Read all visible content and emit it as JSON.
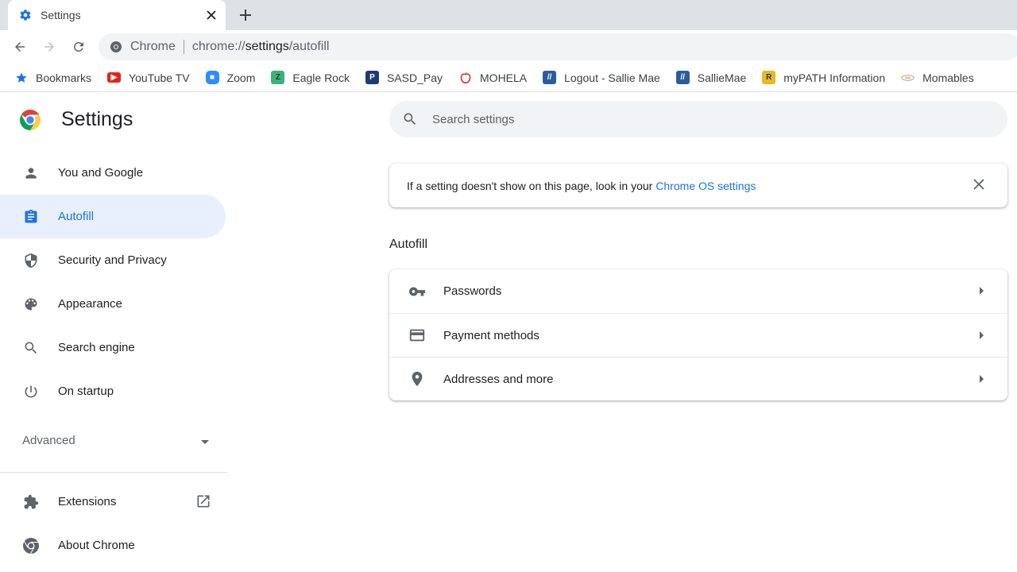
{
  "tab": {
    "title": "Settings",
    "icon": "gear-icon"
  },
  "toolbar": {
    "omnibox_site": "Chrome",
    "url_prefix": "chrome://",
    "url_host": "settings",
    "url_path": "/autofill"
  },
  "bookmarks": [
    {
      "label": "Bookmarks",
      "icon": "star-icon",
      "color": "#1a73e8"
    },
    {
      "label": "YouTube TV",
      "icon": "youtube-tv-icon",
      "color": "#e62117"
    },
    {
      "label": "Zoom",
      "icon": "zoom-icon",
      "color": "#2d8cff"
    },
    {
      "label": "Eagle Rock",
      "icon": "eagle-rock-icon",
      "color": "#3bb27e"
    },
    {
      "label": "SASD_Pay",
      "icon": "sasd-pay-icon",
      "color": "#1d3a7a"
    },
    {
      "label": "MOHELA",
      "icon": "apple-icon",
      "color": "#e02424"
    },
    {
      "label": "Logout - Sallie Mae",
      "icon": "sallie-mae-icon",
      "color": "#2a5d9f"
    },
    {
      "label": "SallieMae",
      "icon": "sallie-mae-icon",
      "color": "#2a5d9f"
    },
    {
      "label": "myPATH Information",
      "icon": "mypath-icon",
      "color": "#1d3a7a"
    },
    {
      "label": "Momables",
      "icon": "momables-icon",
      "color": "#9aa0a6"
    }
  ],
  "sidebar": {
    "title": "Settings",
    "items": [
      {
        "label": "You and Google",
        "icon": "person-icon"
      },
      {
        "label": "Autofill",
        "icon": "clipboard-icon",
        "active": true
      },
      {
        "label": "Security and Privacy",
        "icon": "shield-icon"
      },
      {
        "label": "Appearance",
        "icon": "palette-icon"
      },
      {
        "label": "Search engine",
        "icon": "search-icon"
      },
      {
        "label": "On startup",
        "icon": "power-icon"
      }
    ],
    "advanced_label": "Advanced",
    "bottom_items": [
      {
        "label": "Extensions",
        "icon": "puzzle-icon"
      },
      {
        "label": "About Chrome",
        "icon": "chrome-icon"
      }
    ]
  },
  "main": {
    "search_placeholder": "Search settings",
    "notice_text": "If a setting doesn't show on this page, look in your",
    "notice_link": "Chrome OS settings",
    "section_title": "Autofill",
    "rows": [
      {
        "label": "Passwords",
        "icon": "key-icon"
      },
      {
        "label": "Payment methods",
        "icon": "credit-card-icon"
      },
      {
        "label": "Addresses and more",
        "icon": "location-pin-icon"
      }
    ]
  },
  "colors": {
    "accent": "#1a73e8",
    "active_bg": "#e8f0fe"
  }
}
